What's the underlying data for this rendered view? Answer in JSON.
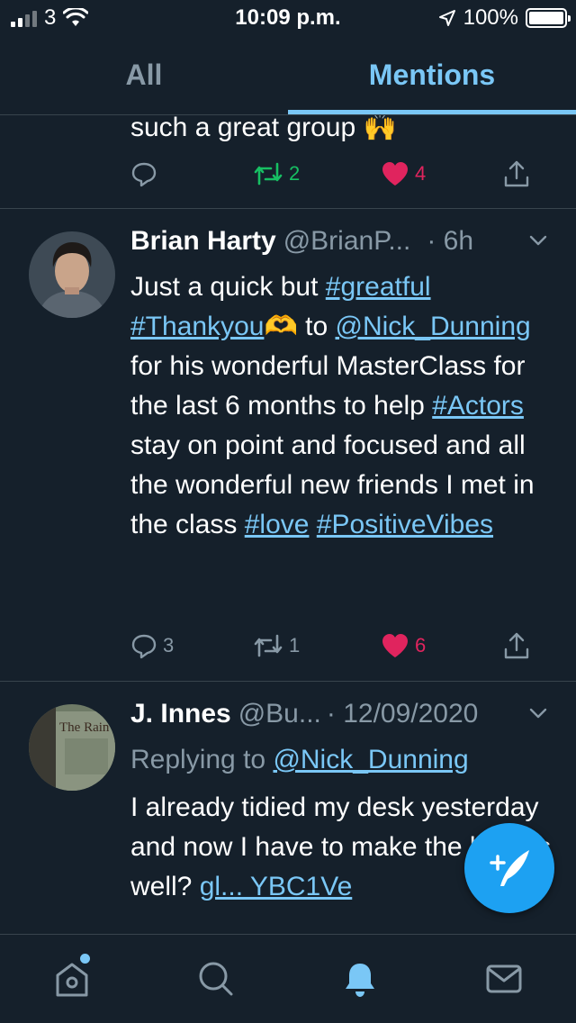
{
  "status_bar": {
    "carrier": "3",
    "time": "10:09 p.m.",
    "battery": "100%"
  },
  "tabs": [
    {
      "label": "All",
      "active": false
    },
    {
      "label": "Mentions",
      "active": true
    }
  ],
  "prev_tweet": {
    "text": "such a great group 🙌",
    "retweets": "2",
    "likes": "4"
  },
  "tweet1": {
    "name": "Brian Harty",
    "handle": "@BrianP...",
    "time": "· 6h",
    "body": {
      "t1": "Just a quick but ",
      "l1": "#greatful",
      "l2": "#Thankyou",
      "t2": "🫶 to ",
      "l3": "@Nick_Dunning",
      "t3": " for his wonderful MasterClass for the last 6 months to help ",
      "l4": "#Actors",
      "t4": " stay on point and focused and all the wonderful new friends I met in the class ",
      "l5": "#love",
      "l6": "#PositiveVibes"
    },
    "replies": "3",
    "retweets": "1",
    "likes": "6"
  },
  "tweet2": {
    "name": "J. Innes",
    "handle": "@Bu...",
    "time": "· 12/09/2020",
    "replying_prefix": "Replying to ",
    "replying_to": "@Nick_Dunning",
    "body_text": "I already tidied my desk yesterday and now I have to make the bed as well? ",
    "body_link": "gl... YBC1Ve",
    "avatar_text": "The Rain"
  },
  "colors": {
    "background": "#15202b",
    "accent": "#7ac7f6",
    "like": "#e0245e",
    "retweet": "#17bf63",
    "muted": "#8899a6"
  },
  "icons": [
    "signal-icon",
    "wifi-icon",
    "location-icon",
    "battery-icon",
    "reply-icon",
    "retweet-icon",
    "like-icon",
    "share-icon",
    "chevron-down-icon",
    "compose-icon",
    "home-icon",
    "search-icon",
    "notifications-icon",
    "messages-icon"
  ]
}
